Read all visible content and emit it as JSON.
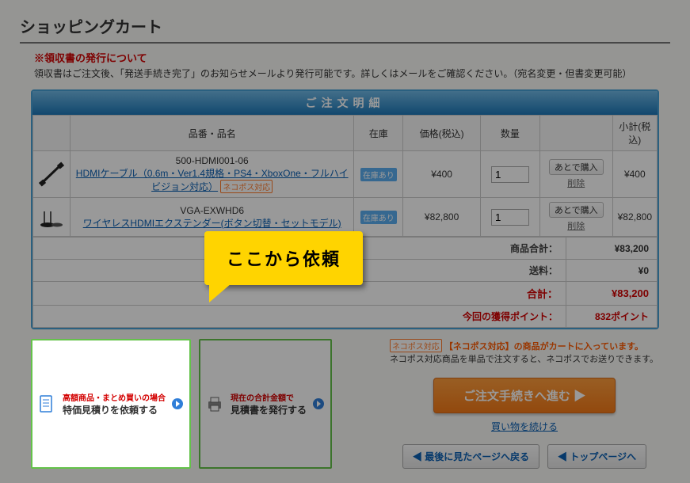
{
  "page": {
    "title": "ショッピングカート"
  },
  "receipt": {
    "title": "※領収書の発行について",
    "body": "領収書はご注文後、「発送手続き完了」のお知らせメールより発行可能です。詳しくはメールをご確認ください。（宛名変更・但書変更可能）"
  },
  "order": {
    "header": "ご注文明細",
    "columns": {
      "name": "品番・品名",
      "stock": "在庫",
      "price": "価格(税込)",
      "qty": "数量",
      "subtotal": "小計(税込)"
    },
    "neko_badge": "ネコポス対応",
    "stock_badge": "在庫あり",
    "later_label": "あとで購入",
    "delete_label": "削除",
    "rows": [
      {
        "model": "500-HDMI001-06",
        "name": "HDMIケーブル（0.6m・Ver1.4規格・PS4・XboxOne・フルハイビジョン対応）",
        "neko": true,
        "stock": "在庫あり",
        "price": "¥400",
        "qty": "1",
        "subtotal": "¥400"
      },
      {
        "model": "VGA-EXWHD6",
        "name": "ワイヤレスHDMIエクステンダー(ボタン切替・セットモデル)",
        "neko": false,
        "stock": "在庫あり",
        "price": "¥82,800",
        "qty": "1",
        "subtotal": "¥82,800"
      }
    ],
    "totals": {
      "sum_label": "商品合計：",
      "sum_value": "¥83,200",
      "ship_label": "送料：",
      "ship_value": "¥0",
      "grand_label": "合計：",
      "grand_value": "¥83,200",
      "points_label": "今回の獲得ポイント：",
      "points_value": "832ポイント"
    }
  },
  "action_cards": {
    "quote_request": {
      "line1": "高額商品・まとめ買いの場合",
      "line2": "特価見積りを依頼する"
    },
    "estimate_print": {
      "line1": "現在の合計金額で",
      "line2": "見積書を発行する"
    }
  },
  "right": {
    "neko_badge": "ネコポス対応",
    "neko_title": "【ネコポス対応】の商品がカートに入っています。",
    "neko_body": "ネコポス対応商品を単品で注文すると、ネコポスでお送りできます。",
    "checkout": "ご注文手続きへ進む ▶",
    "continue": "買い物を続ける",
    "nav_back": "◀ 最後に見たページへ戻る",
    "nav_top": "◀ トップページへ"
  },
  "callout": {
    "text": "ここから依頼"
  },
  "colors": {
    "header_blue": "#1e78b8",
    "border_blue": "#46a0d6",
    "link_blue": "#0a5fb3",
    "danger_red": "#d30000",
    "green": "#64c24a",
    "orange": "#f47a18",
    "yellow": "#ffd400"
  }
}
